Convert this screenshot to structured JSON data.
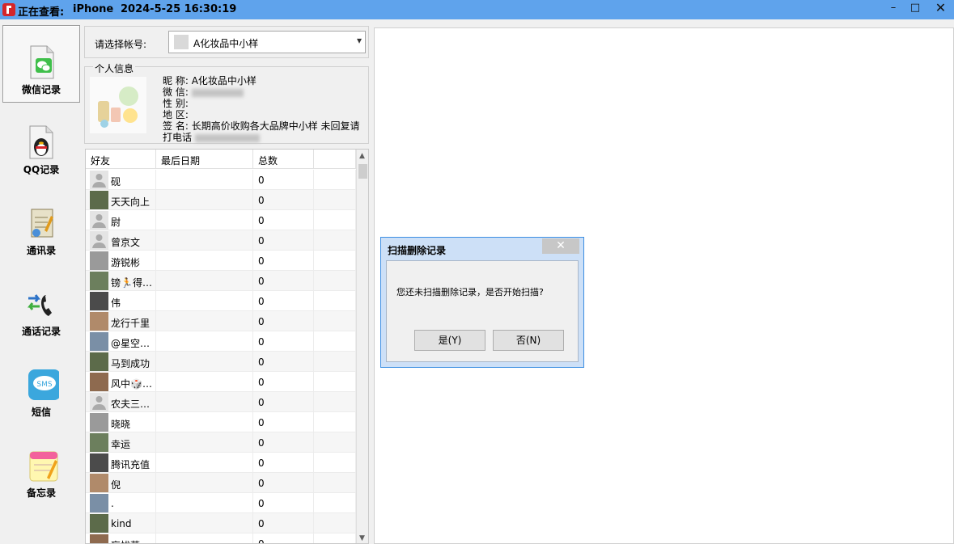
{
  "titlebar": {
    "viewing_label": "正在查看:",
    "device": "iPhone",
    "datetime": "2024-5-25 16:30:19",
    "minimize": "–",
    "maximize": "□",
    "close": "✕"
  },
  "nav": {
    "items": [
      {
        "label": "微信记录",
        "icon": "wechat-icon"
      },
      {
        "label": "QQ记录",
        "icon": "qq-penguin-icon"
      },
      {
        "label": "通讯录",
        "icon": "contacts-book-icon"
      },
      {
        "label": "通话记录",
        "icon": "phone-call-icon"
      },
      {
        "label": "短信",
        "icon": "sms-icon"
      },
      {
        "label": "备忘录",
        "icon": "memo-icon"
      }
    ]
  },
  "account": {
    "label": "请选择帐号:",
    "selected": "A化妆品中小样"
  },
  "profile": {
    "legend": "个人信息",
    "nickname_label": "昵 称:",
    "nickname": "A化妆品中小样",
    "wechat_label": "微 信:",
    "gender_label": "性 别:",
    "region_label": "地 区:",
    "signature_label": "签 名:",
    "signature": "长期高价收购各大品牌中小样 未回复请",
    "signature_line2": "打电话"
  },
  "friends_table": {
    "columns": [
      "好友",
      "最后日期",
      "总数"
    ],
    "rows": [
      {
        "name": "砚",
        "date": "",
        "count": "0",
        "avatar": "default-avatar"
      },
      {
        "name": "天天向上",
        "date": "",
        "count": "0",
        "avatar": "photo-avatar"
      },
      {
        "name": "尉",
        "date": "",
        "count": "0",
        "avatar": "default-avatar"
      },
      {
        "name": "曾京文",
        "date": "",
        "count": "0",
        "avatar": "default-avatar"
      },
      {
        "name": "游锐彬",
        "date": "",
        "count": "0",
        "avatar": "photo-avatar"
      },
      {
        "name": "镑🏃得…",
        "date": "",
        "count": "0",
        "avatar": "photo-avatar"
      },
      {
        "name": "伟",
        "date": "",
        "count": "0",
        "avatar": "photo-avatar"
      },
      {
        "name": "龙行千里",
        "date": "",
        "count": "0",
        "avatar": "photo-avatar"
      },
      {
        "name": "@星空…",
        "date": "",
        "count": "0",
        "avatar": "photo-avatar"
      },
      {
        "name": "马到成功",
        "date": "",
        "count": "0",
        "avatar": "photo-avatar"
      },
      {
        "name": "风中🎲…",
        "date": "",
        "count": "0",
        "avatar": "photo-avatar"
      },
      {
        "name": "农夫三…",
        "date": "",
        "count": "0",
        "avatar": "default-avatar"
      },
      {
        "name": "晓晓",
        "date": "",
        "count": "0",
        "avatar": "photo-avatar"
      },
      {
        "name": "幸运",
        "date": "",
        "count": "0",
        "avatar": "photo-avatar"
      },
      {
        "name": "腾讯充值",
        "date": "",
        "count": "0",
        "avatar": "photo-avatar"
      },
      {
        "name": "倪",
        "date": "",
        "count": "0",
        "avatar": "photo-avatar"
      },
      {
        "name": ".",
        "date": "",
        "count": "0",
        "avatar": "photo-avatar"
      },
      {
        "name": "kind",
        "date": "",
        "count": "0",
        "avatar": "photo-avatar"
      },
      {
        "name": "忘忧草",
        "date": "",
        "count": "0",
        "avatar": "photo-avatar"
      }
    ]
  },
  "dialog": {
    "title": "扫描删除记录",
    "message": "您还未扫描删除记录，是否开始扫描?",
    "yes": "是(Y)",
    "no": "否(N)",
    "close": "✕"
  },
  "colors": {
    "titlebar": "#5fa3ec",
    "dialog_border": "#3b8ee2"
  }
}
